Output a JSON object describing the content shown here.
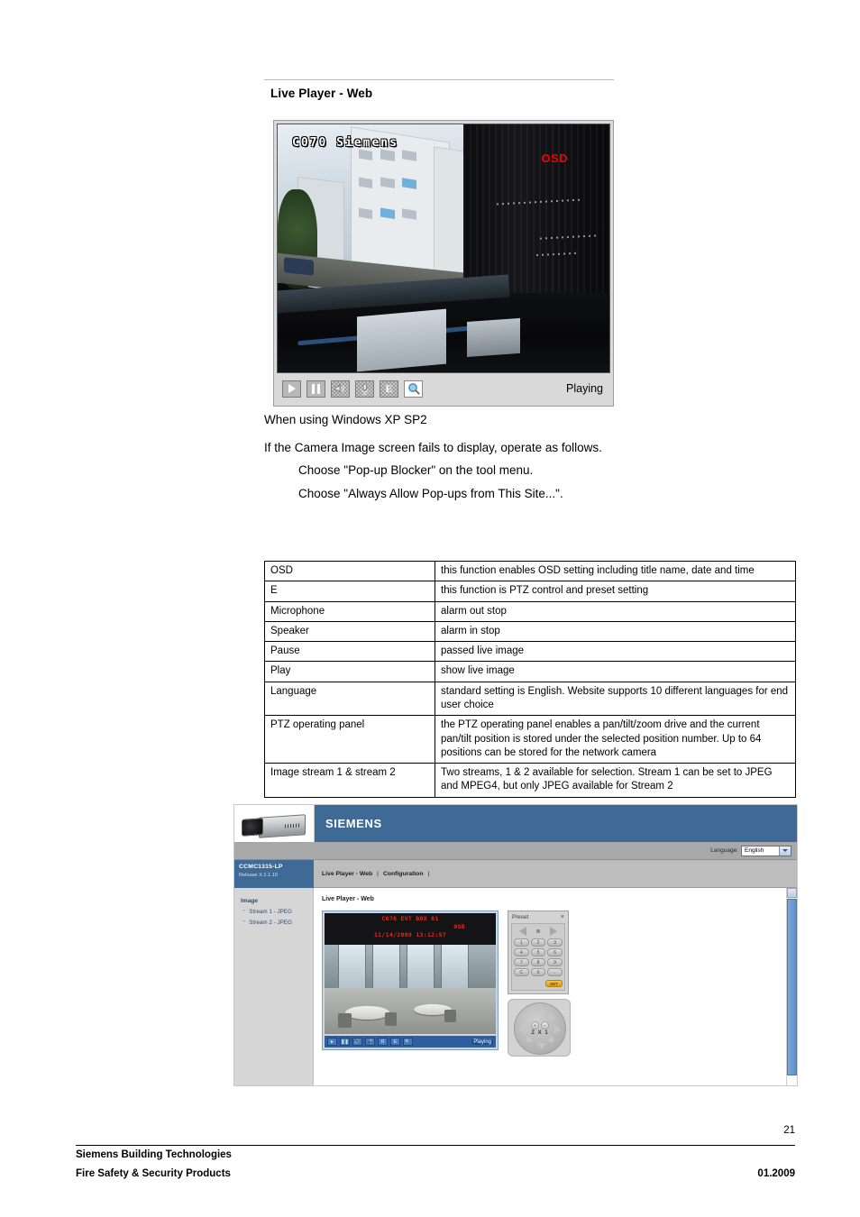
{
  "section": {
    "title": "Live Player - Web"
  },
  "viewer": {
    "osd_title": "C070 Siemens",
    "osd_label": "OSD",
    "status": "Playing",
    "controls": [
      {
        "name": "play-button",
        "label": ""
      },
      {
        "name": "pause-button",
        "label": ""
      },
      {
        "name": "speaker-button",
        "label": ""
      },
      {
        "name": "microphone-button",
        "label": ""
      },
      {
        "name": "e-ptz-button",
        "label": "E"
      },
      {
        "name": "magnifier-button",
        "label": ""
      }
    ]
  },
  "body_text": {
    "line1": "When using Windows XP SP2",
    "line2": "If the Camera Image screen fails to display, operate as follows.",
    "line3": "Choose \"Pop-up Blocker\" on the tool menu.",
    "line4": "Choose \"Always Allow Pop-ups from This Site...\"."
  },
  "function_table": {
    "rows": [
      {
        "key": "OSD",
        "value": "this function enables OSD setting including title name, date and time"
      },
      {
        "key": "E",
        "value": "this function is PTZ control and preset setting"
      },
      {
        "key": "Microphone",
        "value": "alarm out stop"
      },
      {
        "key": "Speaker",
        "value": "alarm in stop"
      },
      {
        "key": "Pause",
        "value": "passed live image"
      },
      {
        "key": "Play",
        "value": "show live image"
      },
      {
        "key": "Language",
        "value": "standard setting is English. Website supports 10 different languages for end user choice"
      },
      {
        "key": "PTZ operating panel",
        "value": "the PTZ operating panel enables a pan/tilt/zoom drive and the current pan/tilt position is stored under the selected position number. Up to 64 positions can be stored for the network camera"
      },
      {
        "key": "Image stream 1 & stream 2",
        "value": "Two streams, 1 & 2 available for selection. Stream 1 can be set to JPEG and MPEG4, but only JPEG available for Stream 2"
      }
    ]
  },
  "webshot": {
    "brand": "SIEMENS",
    "language_label": "Language:",
    "language_value": "English",
    "model": "CCMC1315-LP",
    "release": "Release X.1.1.10",
    "menu": {
      "item1": "Live Player - Web",
      "item2": "Configuration",
      "sep1": "|",
      "sep2": "|"
    },
    "sidebar": {
      "heading": "Image",
      "items": [
        {
          "label": "Stream 1 - JPEG"
        },
        {
          "label": "Stream 2 - JPEG"
        }
      ]
    },
    "page_title": "Live Player - Web",
    "mini_viewer": {
      "osd_line1": "C070 EVT BOX 01",
      "osd_tag": "OSD",
      "osd_line2": "11/14/2008 13:12:57",
      "status": "Playing",
      "buttons": [
        "",
        "",
        "",
        "",
        "",
        "",
        ""
      ]
    },
    "preset": {
      "title": "Preset",
      "close": "×",
      "keys": [
        "1",
        "2",
        "3",
        "4",
        "5",
        "6",
        "7",
        "8",
        "9",
        "C",
        "0",
        "."
      ],
      "set_label": "SET"
    },
    "ptz": {
      "zoom_label": "Z X 1",
      "zoom_in": "+",
      "zoom_out": "−"
    }
  },
  "footer": {
    "page_number": "21",
    "line1": "Siemens Building Technologies",
    "line2": "Fire Safety & Security Products",
    "date": "01.2009"
  },
  "colors": {
    "siemens_blue": "#3f6a96",
    "osd_red": "#ee0000",
    "accent_orange": "#e09a16"
  }
}
